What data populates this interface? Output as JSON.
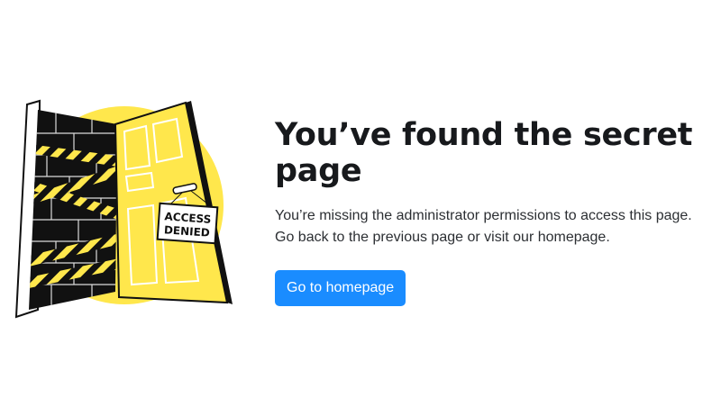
{
  "illustration": {
    "sign_line1": "ACCESS",
    "sign_line2": "DENIED",
    "colors": {
      "yellow": "#ffe74c",
      "black": "#111111"
    }
  },
  "content": {
    "title": "You’ve found the secret page",
    "description": "You’re missing the administrator permissions to access this page. Go back to the previous page or visit our homepage.",
    "button_label": "Go to homepage"
  },
  "colors": {
    "accent": "#1a8cff",
    "text": "#17191c"
  }
}
